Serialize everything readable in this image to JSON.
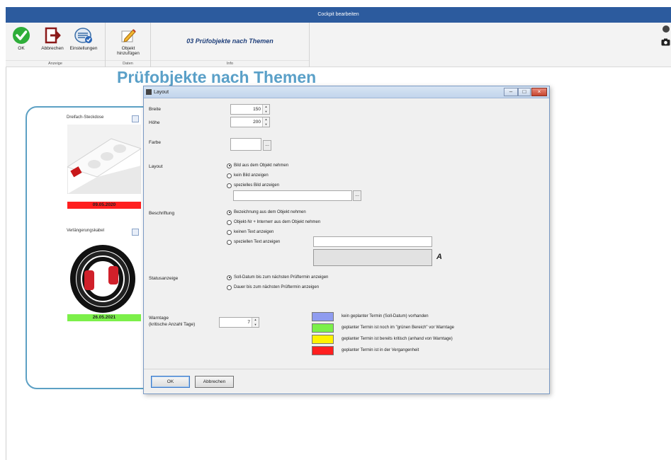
{
  "window": {
    "title": "Cockpit bearbeiten"
  },
  "ribbon": {
    "groups": {
      "anzeige": "Anzeige",
      "daten": "Daten",
      "info": "Info"
    },
    "buttons": {
      "ok": "OK",
      "abbrechen": "Abbrechen",
      "einstellungen": "Einstellungen",
      "objekt": "Objekt hinzufügen"
    },
    "info_title": "03 Prüfobjekte nach Themen"
  },
  "page": {
    "title": "Prüfobjekte nach Themen",
    "items": [
      {
        "title": "Dreifach-Steckdose",
        "date": "09.05.2020",
        "date_color": "#ff1f1f"
      },
      {
        "title": "Verlängerungskabel",
        "date": "26.05.2021",
        "date_color": "#7cf04a"
      }
    ]
  },
  "dialog": {
    "title": "Layout",
    "breite_label": "Breite",
    "breite_value": "150",
    "hoehe_label": "Höhe",
    "hoehe_value": "200",
    "farbe_label": "Farbe",
    "dots": "...",
    "layout_label": "Layout",
    "layout_options": [
      {
        "label": "Bild aus dem Objekt nehmen",
        "selected": true
      },
      {
        "label": "kein Bild anzeigen",
        "selected": false
      },
      {
        "label": "spezielles Bild anzeigen",
        "selected": false
      }
    ],
    "beschriftung_label": "Beschriftung",
    "beschriftung_options": [
      {
        "label": "Bezeichnung aus dem Objekt nehmen",
        "selected": true
      },
      {
        "label": "Objekt-Nr + Internerr aus dem Objekt nehmen",
        "selected": false
      },
      {
        "label": "keinen Text anzeigen",
        "selected": false
      },
      {
        "label": "speziellen Text anzeigen",
        "selected": false
      }
    ],
    "font_button": "A",
    "status_label": "Statusanzeige",
    "status_options": [
      {
        "label": "Soll-Datum bis zum nächsten Prüftermin anzeigen",
        "selected": true
      },
      {
        "label": "Dauer bis zum nächsten Prüftermin anzeigen",
        "selected": false
      }
    ],
    "warntage_label": "Warntage",
    "warntage_sub": "(kritische Anzahl Tage)",
    "warntage_value": "7",
    "legend": [
      {
        "color": "#8f9cf0",
        "text": "kein geplanter Termin (Soll-Datum) vorhanden"
      },
      {
        "color": "#7cf04a",
        "text": "geplanter Termin ist noch im \"grünen Bereich\" vor Warntage"
      },
      {
        "color": "#fff200",
        "text": "geplanter Termin ist bereits kritisch (anhand von Warntage)"
      },
      {
        "color": "#ff1f1f",
        "text": "geplanter Termin ist in der Vergangenheit"
      }
    ],
    "ok_button": "OK",
    "cancel_button": "Abbrechen"
  }
}
